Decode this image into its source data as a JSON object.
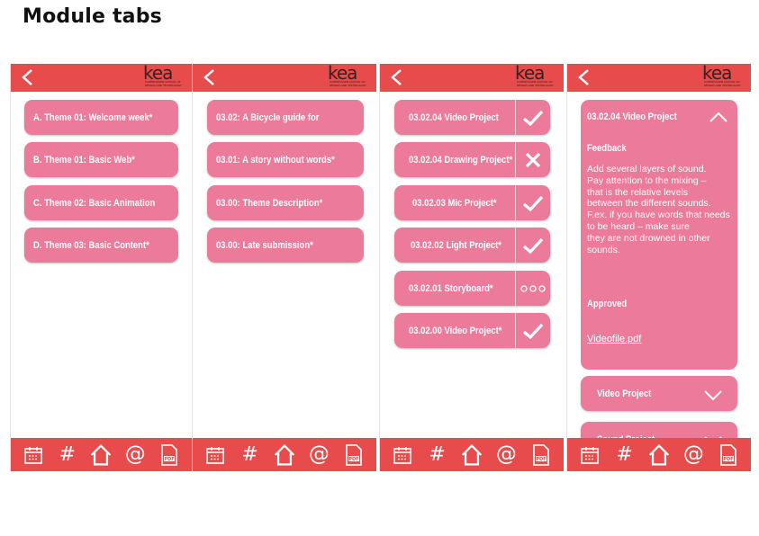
{
  "page_title": "Module tabs",
  "colors": {
    "bar": "#e84b4b",
    "pink": "#ec7a9b",
    "white": "#ffffff"
  },
  "logo": {
    "text": "kea",
    "subtitle": "COPENHAGEN SCHOOL OF DESIGN AND TECHNOLOGY"
  },
  "nav_icons": [
    "calendar-icon",
    "hash-icon",
    "home-icon",
    "at-icon",
    "pdf-icon"
  ],
  "screen1": {
    "items": [
      "A. Theme 01: Welcome week*",
      "B. Theme 01: Basic Web*",
      "C. Theme 02: Basic Animation",
      "D. Theme 03: Basic Content*"
    ]
  },
  "screen2": {
    "items": [
      "03.02: A Bicycle guide for",
      "03.01: A story without words*",
      "03.00: Theme Description*",
      "03.00: Late submission*"
    ]
  },
  "screen3": {
    "items": [
      {
        "label": "03.02.04 Video Project",
        "status": "check"
      },
      {
        "label": "03.02.04 Drawing Project*",
        "status": "cross"
      },
      {
        "label": "03.02.03 Mic Project*",
        "status": "check"
      },
      {
        "label": "03.02.02 Light Project*",
        "status": "check"
      },
      {
        "label": "03.02.01 Storyboard*",
        "status": "pending"
      },
      {
        "label": "03.02.00 Video Project*",
        "status": "check"
      }
    ]
  },
  "screen4": {
    "detail_title": "03.02.04 Video Project",
    "feedback_heading": "Feedback",
    "feedback_lines": [
      "Add several layers of sound.",
      "Pay attention to the mixing –",
      "that is the relative levels",
      "between the different sounds.",
      "F.ex. if you have words that needs",
      "to be heard – make sure",
      "they are not drowned in other",
      "sounds."
    ],
    "approved_label": "Approved",
    "file_link": "Videofile.pdf",
    "collapsed_items": [
      "Video Project",
      "Sound Project"
    ]
  }
}
